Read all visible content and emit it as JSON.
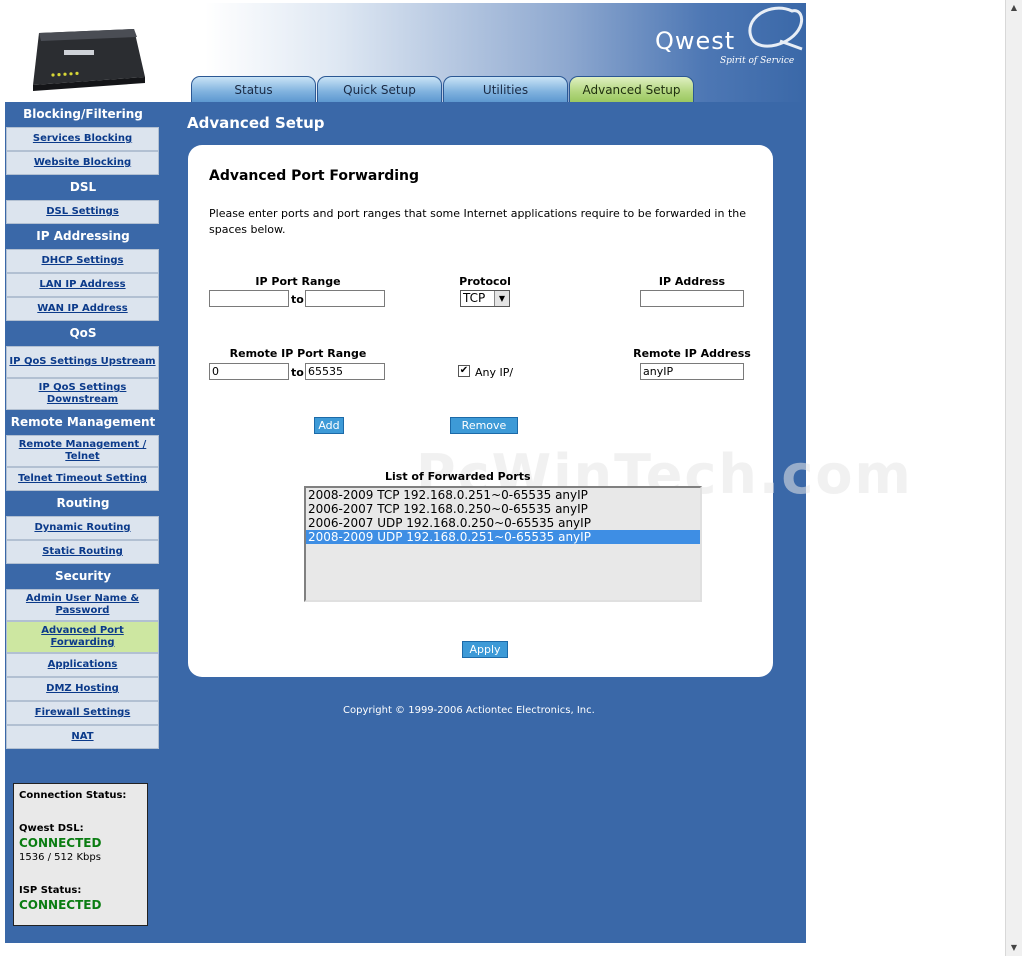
{
  "header": {
    "logo_text": "Qwest",
    "logo_tagline": "Spirit of Service"
  },
  "tabs": [
    {
      "label": "Status"
    },
    {
      "label": "Quick Setup"
    },
    {
      "label": "Utilities"
    },
    {
      "label": "Advanced Setup"
    }
  ],
  "sidebar": {
    "groups": [
      {
        "heading": "Blocking/Filtering",
        "items": [
          "Services Blocking",
          "Website Blocking"
        ]
      },
      {
        "heading": "DSL",
        "items": [
          "DSL Settings"
        ]
      },
      {
        "heading": "IP Addressing",
        "items": [
          "DHCP Settings",
          "LAN IP Address",
          "WAN IP Address"
        ]
      },
      {
        "heading": "QoS",
        "items": [
          "IP QoS Settings Upstream",
          "IP QoS Settings Downstream"
        ]
      },
      {
        "heading": "Remote Management",
        "items": [
          "Remote Management / Telnet",
          "Telnet Timeout Setting"
        ]
      },
      {
        "heading": "Routing",
        "items": [
          "Dynamic Routing",
          "Static Routing"
        ]
      },
      {
        "heading": "Security",
        "items": [
          "Admin User Name & Password",
          "Advanced Port Forwarding",
          "Applications",
          "DMZ Hosting",
          "Firewall Settings",
          "NAT"
        ]
      }
    ]
  },
  "status": {
    "connection_label": "Connection Status:",
    "dsl_label": "Qwest DSL:",
    "dsl_value": "CONNECTED",
    "dsl_speed": "1536 / 512 Kbps",
    "isp_label": "ISP Status:",
    "isp_value": "CONNECTED"
  },
  "main": {
    "title": "Advanced Setup",
    "panel_title": "Advanced Port Forwarding",
    "description": "Please enter ports and port ranges that some Internet applications require to be forwarded in the spaces below.",
    "ip_port_range_label": "IP Port Range",
    "protocol_label": "Protocol",
    "ip_address_label": "IP Address",
    "to_label": "to",
    "port_start": "",
    "port_end": "",
    "protocol_value": "TCP",
    "ip_address_value": "",
    "remote_port_range_label": "Remote IP Port Range",
    "remote_ip_address_label": "Remote IP Address",
    "remote_port_start": "0",
    "remote_port_end": "65535",
    "any_ip_label": "Any IP/",
    "any_ip_checked": true,
    "remote_ip_value": "anyIP",
    "add_label": "Add",
    "remove_label": "Remove",
    "list_title": "List of Forwarded Ports",
    "forwarded_ports": [
      "2008-2009 TCP 192.168.0.251~0-65535 anyIP",
      "2006-2007 TCP 192.168.0.250~0-65535 anyIP",
      "2006-2007 UDP 192.168.0.250~0-65535 anyIP",
      "2008-2009 UDP 192.168.0.251~0-65535 anyIP"
    ],
    "selected_index": 3,
    "apply_label": "Apply",
    "watermark": "PcWinTech.com"
  },
  "footer": {
    "copyright": "Copyright © 1999-2006 Actiontec Electronics, Inc."
  },
  "colors": {
    "page_bg": "#3a68a8",
    "active_tab": "#b2d67e",
    "sidebar_active": "#cde7a1",
    "connected": "#0a7d12",
    "button": "#3d9ad7",
    "selected_row": "#3e8ee4"
  }
}
